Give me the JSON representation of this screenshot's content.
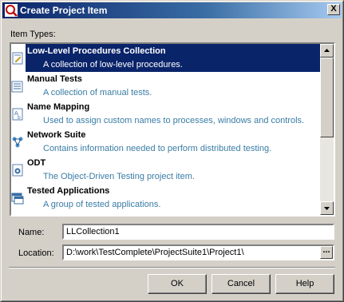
{
  "window": {
    "title": "Create Project Item",
    "close_label": "X"
  },
  "item_types": {
    "label": "Item Types:",
    "selected_index": 0,
    "items": [
      {
        "name": "Low-Level Procedures Collection",
        "description": "A collection of low-level procedures.",
        "icon": "procedures-icon"
      },
      {
        "name": "Manual Tests",
        "description": "A collection of manual tests.",
        "icon": "manual-tests-icon"
      },
      {
        "name": "Name Mapping",
        "description": "Used to assign custom names to processes, windows and controls.",
        "icon": "name-mapping-icon"
      },
      {
        "name": "Network Suite",
        "description": "Contains information needed to perform distributed testing.",
        "icon": "network-suite-icon"
      },
      {
        "name": "ODT",
        "description": "The Object-Driven Testing project item.",
        "icon": "odt-icon"
      },
      {
        "name": "Tested Applications",
        "description": "A group of tested applications.",
        "icon": "tested-apps-icon"
      }
    ]
  },
  "form": {
    "name_label": "Name:",
    "name_value": "LLCollection1",
    "location_label": "Location:",
    "location_value": "D:\\work\\TestComplete\\ProjectSuite1\\Project1\\",
    "browse_label": "..."
  },
  "buttons": {
    "ok": "OK",
    "cancel": "Cancel",
    "help": "Help"
  }
}
